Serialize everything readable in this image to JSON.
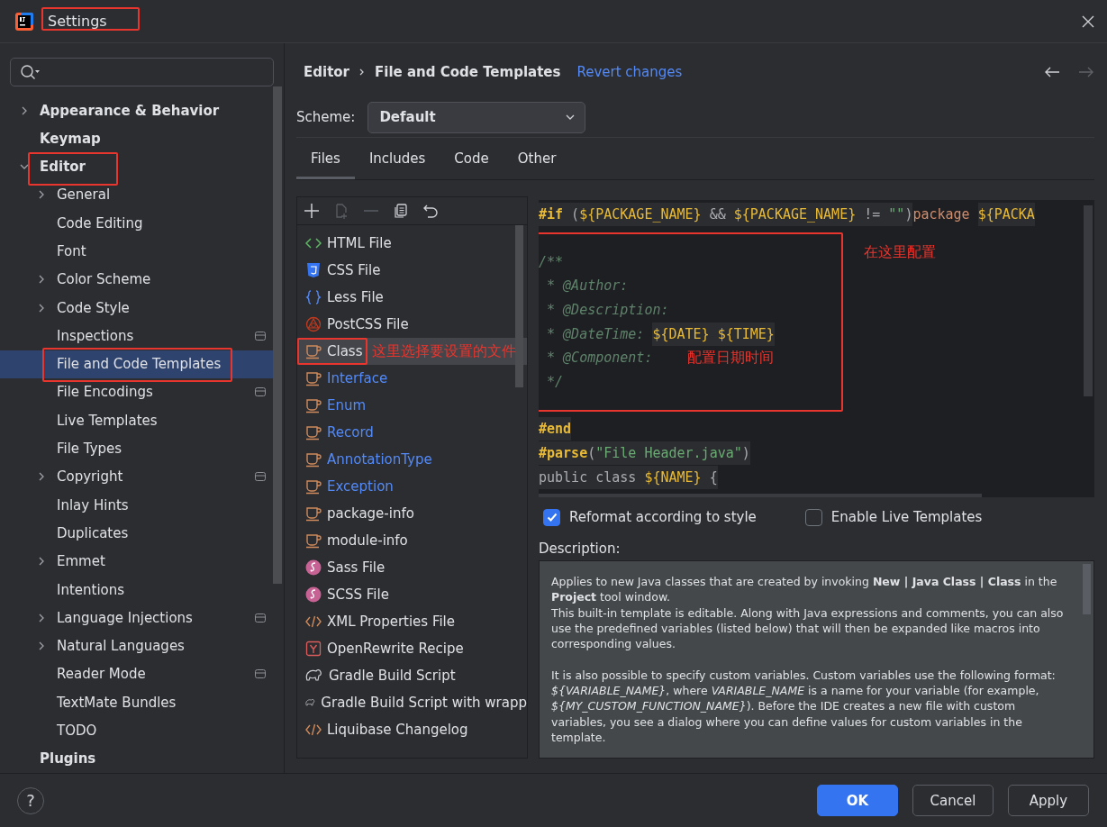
{
  "window": {
    "title": "Settings",
    "highlighted": true
  },
  "sidebar": {
    "items": [
      {
        "label": "Appearance & Behavior",
        "expanded": false,
        "selected": false,
        "highlighted": false
      },
      {
        "label": "Keymap",
        "selected": false,
        "highlighted": false
      },
      {
        "label": "Editor",
        "expanded": true,
        "selected": false,
        "highlighted": true,
        "children": [
          {
            "label": "General",
            "expanded": false,
            "selected": false,
            "scoped": false,
            "highlighted": false
          },
          {
            "label": "Code Editing",
            "selected": false,
            "scoped": false,
            "highlighted": false
          },
          {
            "label": "Font",
            "selected": false,
            "scoped": false,
            "highlighted": false
          },
          {
            "label": "Color Scheme",
            "expanded": false,
            "selected": false,
            "scoped": false,
            "highlighted": false
          },
          {
            "label": "Code Style",
            "expanded": false,
            "selected": false,
            "scoped": false,
            "highlighted": false
          },
          {
            "label": "Inspections",
            "selected": false,
            "scoped": true,
            "highlighted": false
          },
          {
            "label": "File and Code Templates",
            "selected": true,
            "scoped": false,
            "highlighted": true
          },
          {
            "label": "File Encodings",
            "selected": false,
            "scoped": true,
            "highlighted": false
          },
          {
            "label": "Live Templates",
            "selected": false,
            "scoped": false,
            "highlighted": false
          },
          {
            "label": "File Types",
            "selected": false,
            "scoped": false,
            "highlighted": false
          },
          {
            "label": "Copyright",
            "expanded": false,
            "selected": false,
            "scoped": true,
            "highlighted": false
          },
          {
            "label": "Inlay Hints",
            "selected": false,
            "scoped": false,
            "highlighted": false
          },
          {
            "label": "Duplicates",
            "selected": false,
            "scoped": false,
            "highlighted": false
          },
          {
            "label": "Emmet",
            "expanded": false,
            "selected": false,
            "scoped": false,
            "highlighted": false
          },
          {
            "label": "Intentions",
            "selected": false,
            "scoped": false,
            "highlighted": false
          },
          {
            "label": "Language Injections",
            "expanded": false,
            "selected": false,
            "scoped": true,
            "highlighted": false
          },
          {
            "label": "Natural Languages",
            "expanded": false,
            "selected": false,
            "scoped": false,
            "highlighted": false
          },
          {
            "label": "Reader Mode",
            "selected": false,
            "scoped": true,
            "highlighted": false
          },
          {
            "label": "TextMate Bundles",
            "selected": false,
            "scoped": false,
            "highlighted": false
          },
          {
            "label": "TODO",
            "selected": false,
            "scoped": false,
            "highlighted": false
          }
        ]
      },
      {
        "label": "Plugins",
        "selected": false,
        "highlighted": false
      }
    ]
  },
  "breadcrumb": [
    "Editor",
    "File and Code Templates"
  ],
  "revert_link": "Revert changes",
  "scheme": {
    "label": "Scheme:",
    "value": "Default"
  },
  "tabs": [
    {
      "label": "Files",
      "selected": true
    },
    {
      "label": "Includes",
      "selected": false
    },
    {
      "label": "Code",
      "selected": false
    },
    {
      "label": "Other",
      "selected": false
    }
  ],
  "toolbar": [
    {
      "kind": "add",
      "disabled": false
    },
    {
      "kind": "new",
      "disabled": true
    },
    {
      "kind": "remove",
      "disabled": true
    },
    {
      "kind": "copy",
      "disabled": false
    },
    {
      "kind": "reset",
      "disabled": false
    }
  ],
  "files": [
    {
      "kind": "html",
      "label": "HTML File",
      "modified": false,
      "selected": false,
      "highlighted": false
    },
    {
      "kind": "css",
      "label": "CSS File",
      "modified": false,
      "selected": false,
      "highlighted": false
    },
    {
      "kind": "less",
      "label": "Less File",
      "modified": false,
      "selected": false,
      "highlighted": false
    },
    {
      "kind": "postcss",
      "label": "PostCSS File",
      "modified": false,
      "selected": false,
      "highlighted": false
    },
    {
      "kind": "java",
      "label": "Class",
      "modified": false,
      "selected": true,
      "highlighted": true,
      "note": "这里选择要设置的文件"
    },
    {
      "kind": "java",
      "label": "Interface",
      "modified": true,
      "selected": false,
      "highlighted": false
    },
    {
      "kind": "java",
      "label": "Enum",
      "modified": true,
      "selected": false,
      "highlighted": false
    },
    {
      "kind": "java",
      "label": "Record",
      "modified": true,
      "selected": false,
      "highlighted": false
    },
    {
      "kind": "java",
      "label": "AnnotationType",
      "modified": true,
      "selected": false,
      "highlighted": false
    },
    {
      "kind": "java",
      "label": "Exception",
      "modified": true,
      "selected": false,
      "highlighted": false
    },
    {
      "kind": "java",
      "label": "package-info",
      "modified": false,
      "selected": false,
      "highlighted": false
    },
    {
      "kind": "java",
      "label": "module-info",
      "modified": false,
      "selected": false,
      "highlighted": false
    },
    {
      "kind": "sass",
      "label": "Sass File",
      "modified": false,
      "selected": false,
      "highlighted": false
    },
    {
      "kind": "sass",
      "label": "SCSS File",
      "modified": false,
      "selected": false,
      "highlighted": false
    },
    {
      "kind": "xml",
      "label": "XML Properties File",
      "modified": false,
      "selected": false,
      "highlighted": false
    },
    {
      "kind": "yaml",
      "label": "OpenRewrite Recipe",
      "modified": false,
      "selected": false,
      "highlighted": false
    },
    {
      "kind": "gradle",
      "label": "Gradle Build Script",
      "modified": false,
      "selected": false,
      "highlighted": false
    },
    {
      "kind": "gradle",
      "label": "Gradle Build Script with wrapp",
      "modified": false,
      "selected": false,
      "highlighted": false
    },
    {
      "kind": "xml",
      "label": "Liquibase Changelog",
      "modified": false,
      "selected": false,
      "highlighted": false
    }
  ],
  "code": [
    {
      "highlighted": false,
      "lines": [
        {
          "segments": [
            {
              "kind": "dir",
              "text": "#if"
            },
            {
              "kind": "tpl",
              "text": " ("
            },
            {
              "kind": "var",
              "text": "${PACKAGE_NAME}"
            },
            {
              "kind": "tpl",
              "text": " && "
            },
            {
              "kind": "var",
              "text": "${PACKAGE_NAME}"
            },
            {
              "kind": "tpl",
              "text": " != "
            },
            {
              "kind": "str",
              "text": "\"\""
            },
            {
              "kind": "tpl",
              "text": ")"
            },
            {
              "kind": "java",
              "text": "package "
            },
            {
              "kind": "var",
              "text": "${PACKA"
            }
          ]
        }
      ]
    },
    {
      "highlighted": true,
      "lines": [
        {
          "segments": [
            {
              "kind": "comment",
              "text": "/**"
            }
          ],
          "note": "在这里配置"
        },
        {
          "segments": [
            {
              "kind": "comment",
              "text": " * @Author:"
            }
          ]
        },
        {
          "segments": [
            {
              "kind": "comment",
              "text": " * @Description:"
            }
          ]
        },
        {
          "segments": [
            {
              "kind": "comment",
              "text": " * @DateTime: "
            },
            {
              "kind": "var",
              "text": "${DATE} ${TIME}"
            }
          ]
        },
        {
          "segments": [
            {
              "kind": "comment",
              "text": " * @Component:"
            }
          ],
          "note": "配置日期时间"
        },
        {
          "segments": [
            {
              "kind": "comment",
              "text": " */"
            }
          ]
        }
      ]
    },
    {
      "highlighted": false,
      "lines": [
        {
          "segments": [
            {
              "kind": "dir",
              "text": "#end"
            }
          ]
        },
        {
          "segments": [
            {
              "kind": "dir",
              "text": "#parse"
            },
            {
              "kind": "tpl",
              "text": "("
            },
            {
              "kind": "str",
              "text": "\"File Header.java\""
            },
            {
              "kind": "tpl",
              "text": ")"
            }
          ]
        },
        {
          "segments": [
            {
              "kind": "tpl",
              "text": "public class "
            },
            {
              "kind": "var",
              "text": "${NAME}"
            },
            {
              "kind": "tpl",
              "text": " {"
            }
          ]
        }
      ]
    }
  ],
  "options": [
    {
      "label": "Reformat according to style",
      "checked": true
    },
    {
      "label": "Enable Live Templates",
      "checked": false
    }
  ],
  "description": {
    "label": "Description:",
    "paragraphs": [
      [
        "Applies to new Java classes that are created by invoking **New | Java Class | Class** in the **Project** tool window.",
        "This built-in template is editable. Along with Java expressions and comments, you can also use the predefined variables (listed below) that will then be expanded like macros into corresponding values."
      ],
      [
        "It is also possible to specify custom variables. Custom variables use the following format: *${VARIABLE_NAME}*, where *VARIABLE_NAME* is a name for your variable (for example, *${MY_CUSTOM_FUNCTION_NAME}*). Before the IDE creates a new file with custom variables, you see a dialog where you can define values for custom variables in the template."
      ]
    ]
  },
  "help": "?",
  "buttons": [
    {
      "label": "OK",
      "primary": true
    },
    {
      "label": "Cancel",
      "primary": false
    },
    {
      "label": "Apply",
      "primary": false
    }
  ]
}
